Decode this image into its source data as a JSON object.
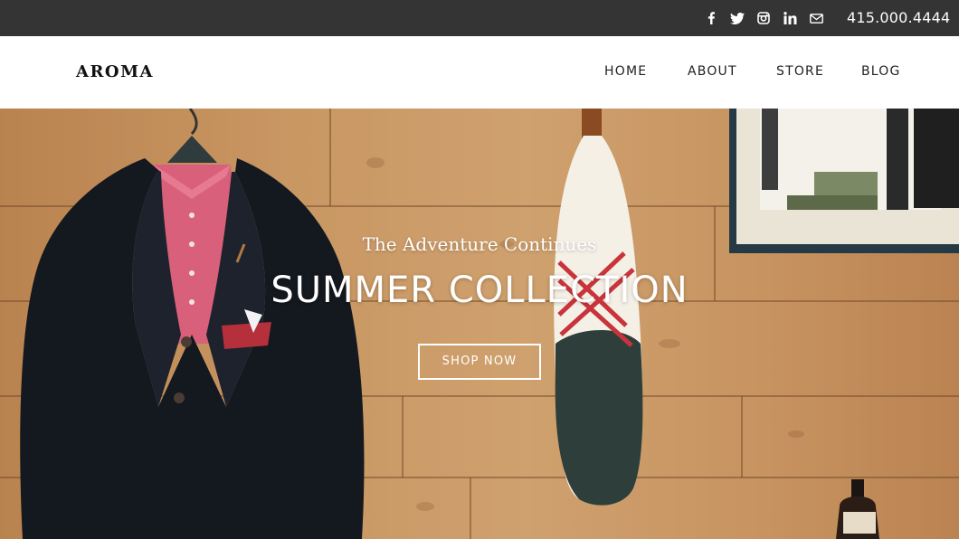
{
  "topbar": {
    "social": [
      {
        "name": "facebook-icon"
      },
      {
        "name": "twitter-icon"
      },
      {
        "name": "instagram-icon"
      },
      {
        "name": "linkedin-icon"
      },
      {
        "name": "mail-icon"
      }
    ],
    "phone": "415.000.4444"
  },
  "header": {
    "logo": "AROMA",
    "nav": [
      "HOME",
      "ABOUT",
      "STORE",
      "BLOG"
    ]
  },
  "hero": {
    "subtitle": "The Adventure Continues",
    "title": "SUMMER COLLECTION",
    "cta": "SHOP NOW"
  },
  "colors": {
    "topbar_bg": "#343434",
    "header_bg": "#ffffff",
    "text_dark": "#222222",
    "hero_text": "#ffffff"
  }
}
